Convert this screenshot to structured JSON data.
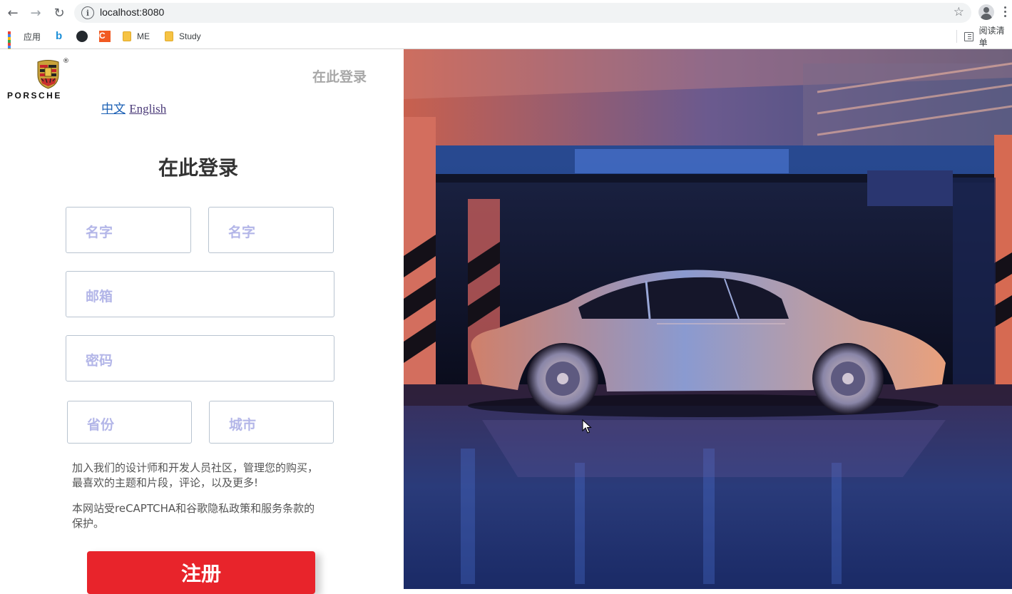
{
  "browser": {
    "url": "localhost:8080",
    "bookmarks": [
      {
        "label": "应用",
        "icon": "apps-grid-icon"
      },
      {
        "label": "",
        "icon": "bing-icon"
      },
      {
        "label": "",
        "icon": "github-icon"
      },
      {
        "label": "",
        "icon": "c-icon"
      },
      {
        "label": "ME",
        "icon": "folder-icon"
      },
      {
        "label": "Study",
        "icon": "folder-icon"
      }
    ],
    "reading_list": "阅读清单"
  },
  "header": {
    "logo_text": "PORSCHE",
    "logo_mark": "®",
    "top_link": "在此登录",
    "lang_zh": "中文",
    "lang_en": "English"
  },
  "form": {
    "title": "在此登录",
    "first_name_placeholder": "名字",
    "last_name_placeholder": "名字",
    "email_placeholder": "邮箱",
    "password_placeholder": "密码",
    "province_placeholder": "省份",
    "city_placeholder": "城市",
    "desc1": "加入我们的设计师和开发人员社区，管理您的购买，最喜欢的主题和片段，评论，以及更多!",
    "desc2": "本网站受reCAPTCHA和谷歌隐私政策和服务条款的保护。",
    "submit_label": "注册"
  },
  "colors": {
    "accent": "#e8242b",
    "placeholder": "#b3b6e8",
    "title": "#333333"
  }
}
